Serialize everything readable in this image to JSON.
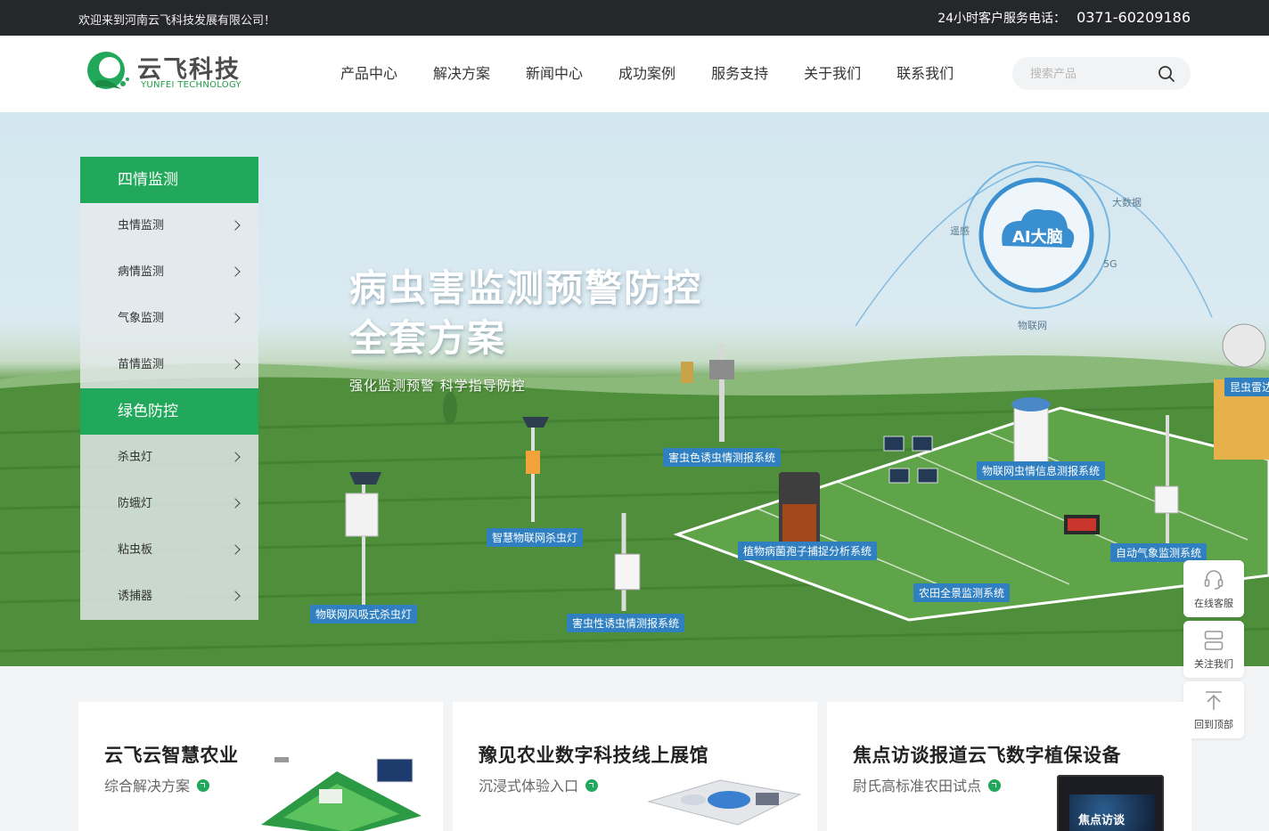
{
  "topbar": {
    "welcome": "欢迎来到河南云飞科技发展有限公司！",
    "hotline_label": "24小时客户服务电话：",
    "hotline_number": "0371-60209186"
  },
  "logo": {
    "name_cn": "云飞科技",
    "name_en": "YUNFEI TECHNOLOGY"
  },
  "nav": {
    "items": [
      "产品中心",
      "解决方案",
      "新闻中心",
      "成功案例",
      "服务支持",
      "关于我们",
      "联系我们"
    ]
  },
  "search": {
    "placeholder": "搜索产品",
    "icon": "search-icon"
  },
  "banner": {
    "title_line1": "病虫害监测预警防控",
    "title_line2": "全套方案",
    "subtitle": "强化监测预警 科学指导防控",
    "ai_label": "AI大脑",
    "ring_labels": [
      "遥感",
      "大数据",
      "5G",
      "物联网"
    ],
    "system_tags": [
      "害虫色诱虫情测报系统",
      "物联网虫情信息测报系统",
      "智慧物联网杀虫灯",
      "植物病菌孢子捕捉分析系统",
      "自动气象监测系统",
      "农田全景监测系统",
      "物联网风吸式杀虫灯",
      "害虫性诱虫情测报系统",
      "昆虫雷达"
    ],
    "colors": {
      "brand_green": "#22a85a",
      "tag_blue": "#2f7fc1"
    }
  },
  "sidemenu": {
    "groups": [
      {
        "title": "四情监测",
        "items": [
          "虫情监测",
          "病情监测",
          "气象监测",
          "苗情监测"
        ]
      },
      {
        "title": "绿色防控",
        "items": [
          "杀虫灯",
          "防蛾灯",
          "粘虫板",
          "诱捕器"
        ]
      }
    ]
  },
  "tools": [
    {
      "label": "在线客服",
      "icon": "headset-icon"
    },
    {
      "label": "关注我们",
      "icon": "qrcode-icon"
    },
    {
      "label": "回到顶部",
      "icon": "arrow-up-icon"
    }
  ],
  "cards": [
    {
      "title": "云飞云智慧农业",
      "subtitle": "综合解决方案"
    },
    {
      "title": "豫见农业数字科技线上展馆",
      "subtitle": "沉浸式体验入口"
    },
    {
      "title": "焦点访谈报道云飞数字植保设备",
      "subtitle": "尉氏高标准农田试点"
    }
  ],
  "card3_screen_text": "焦点访谈"
}
